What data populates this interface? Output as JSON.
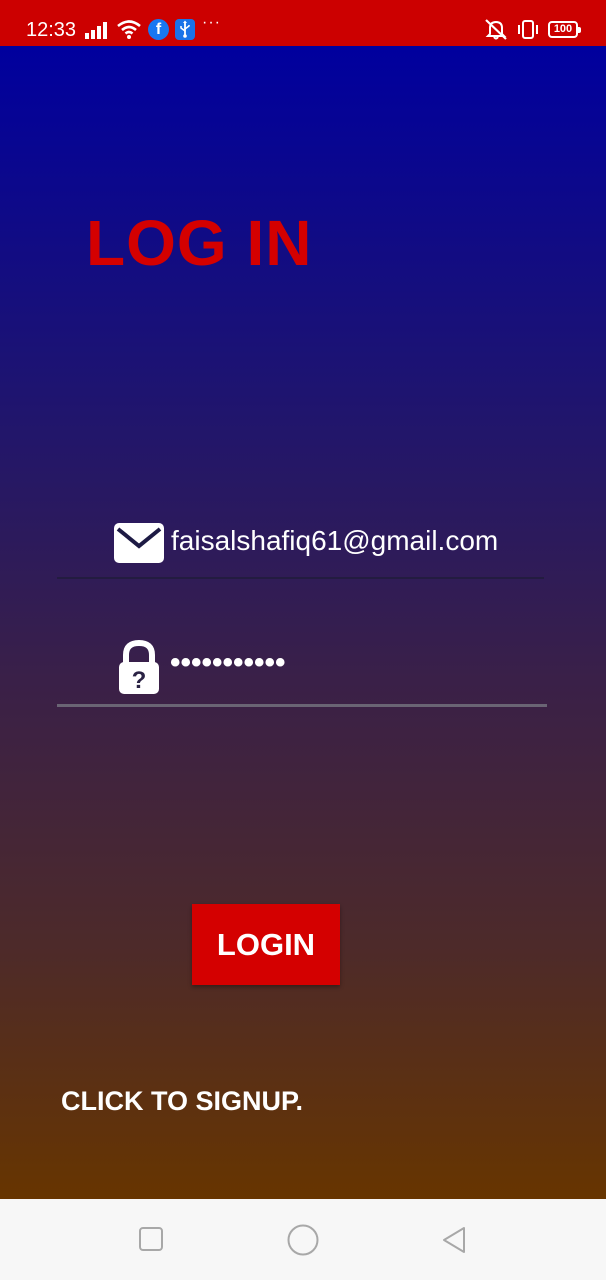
{
  "status_bar": {
    "time": "12:33",
    "battery": "100",
    "icons": [
      "signal-icon",
      "wifi-icon",
      "facebook-icon",
      "usb-icon",
      "more-icon",
      "mute-icon",
      "vibrate-icon",
      "battery-icon"
    ],
    "facebook_glyph": "f",
    "more": "···"
  },
  "page": {
    "title": "LOG IN",
    "email_value": "faisalshafiq61@gmail.com",
    "password_value": "•••••••••••",
    "login_label": "LOGIN",
    "signup_label": "CLICK TO SIGNUP."
  },
  "colors": {
    "status_bar": "#cc0000",
    "title": "#d40000",
    "button": "#d40000",
    "gradient_top": "#00009e",
    "gradient_bottom": "#673500",
    "nav_bar": "#f7f7f7"
  },
  "nav_bar": {
    "icons": [
      "recents-icon",
      "home-icon",
      "back-icon"
    ]
  }
}
